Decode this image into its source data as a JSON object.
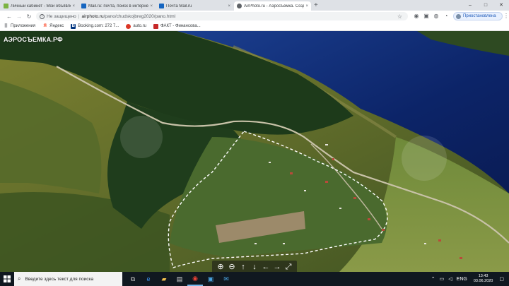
{
  "browser": {
    "tabs": [
      {
        "title": "Личный кабинет - Мои объявления",
        "favicon_color": "#7cb342",
        "active": false
      },
      {
        "title": "Mail.ru: почта, поиск в интернете",
        "favicon_color": "#1565c0",
        "active": false
      },
      {
        "title": "Почта Mail.ru",
        "favicon_color": "#1565c0",
        "active": false
      },
      {
        "title": "AirPhoto.ru - Аэросъемка. Создание",
        "favicon_color": "#5f6368",
        "active": true
      }
    ],
    "new_tab_icon": "plus-icon",
    "close_tab_glyph": "×",
    "window_controls": [
      "–",
      "□",
      "✕"
    ],
    "address": {
      "security_label": "Не защищено",
      "separator": "|",
      "host": "airphoto.ru",
      "path": "/pano/chudskojbreg2020/pano.html"
    },
    "profile_label": "Приостановлена",
    "bookmarks": [
      {
        "label": "Приложения",
        "icon": "apps-grid-icon",
        "color": "#5f6368"
      },
      {
        "label": "Яндекс",
        "icon": "yandex-icon",
        "color": "#fc3f1d"
      },
      {
        "label": "Booking.com: 272 7...",
        "icon": "booking-icon",
        "color": "#003580"
      },
      {
        "label": "auto.ru",
        "icon": "auto-icon",
        "color": "#db3727"
      },
      {
        "label": "ФАКТ - Финансова...",
        "icon": "fakt-icon",
        "color": "#c62828"
      }
    ]
  },
  "page": {
    "watermark": "АЭРОСЪЕМКА.РФ",
    "pano_controls": [
      {
        "glyph": "⊕",
        "name": "zoom-in-button"
      },
      {
        "glyph": "⊖",
        "name": "zoom-out-button"
      },
      {
        "glyph": "↑",
        "name": "pan-up-button"
      },
      {
        "glyph": "↓",
        "name": "pan-down-button"
      },
      {
        "glyph": "←",
        "name": "pan-left-button"
      },
      {
        "glyph": "→",
        "name": "pan-right-button"
      },
      {
        "glyph": "⤢",
        "name": "fullscreen-button"
      }
    ]
  },
  "taskbar": {
    "search_placeholder": "Введите здесь текст для поиска",
    "language": "ENG",
    "time": "13:43",
    "date": "03.06.2020"
  },
  "colors": {
    "water": "#0f2a6e",
    "forest": "#1d3a1a",
    "field": "#8a8d3a",
    "taskbar": "#101820"
  }
}
